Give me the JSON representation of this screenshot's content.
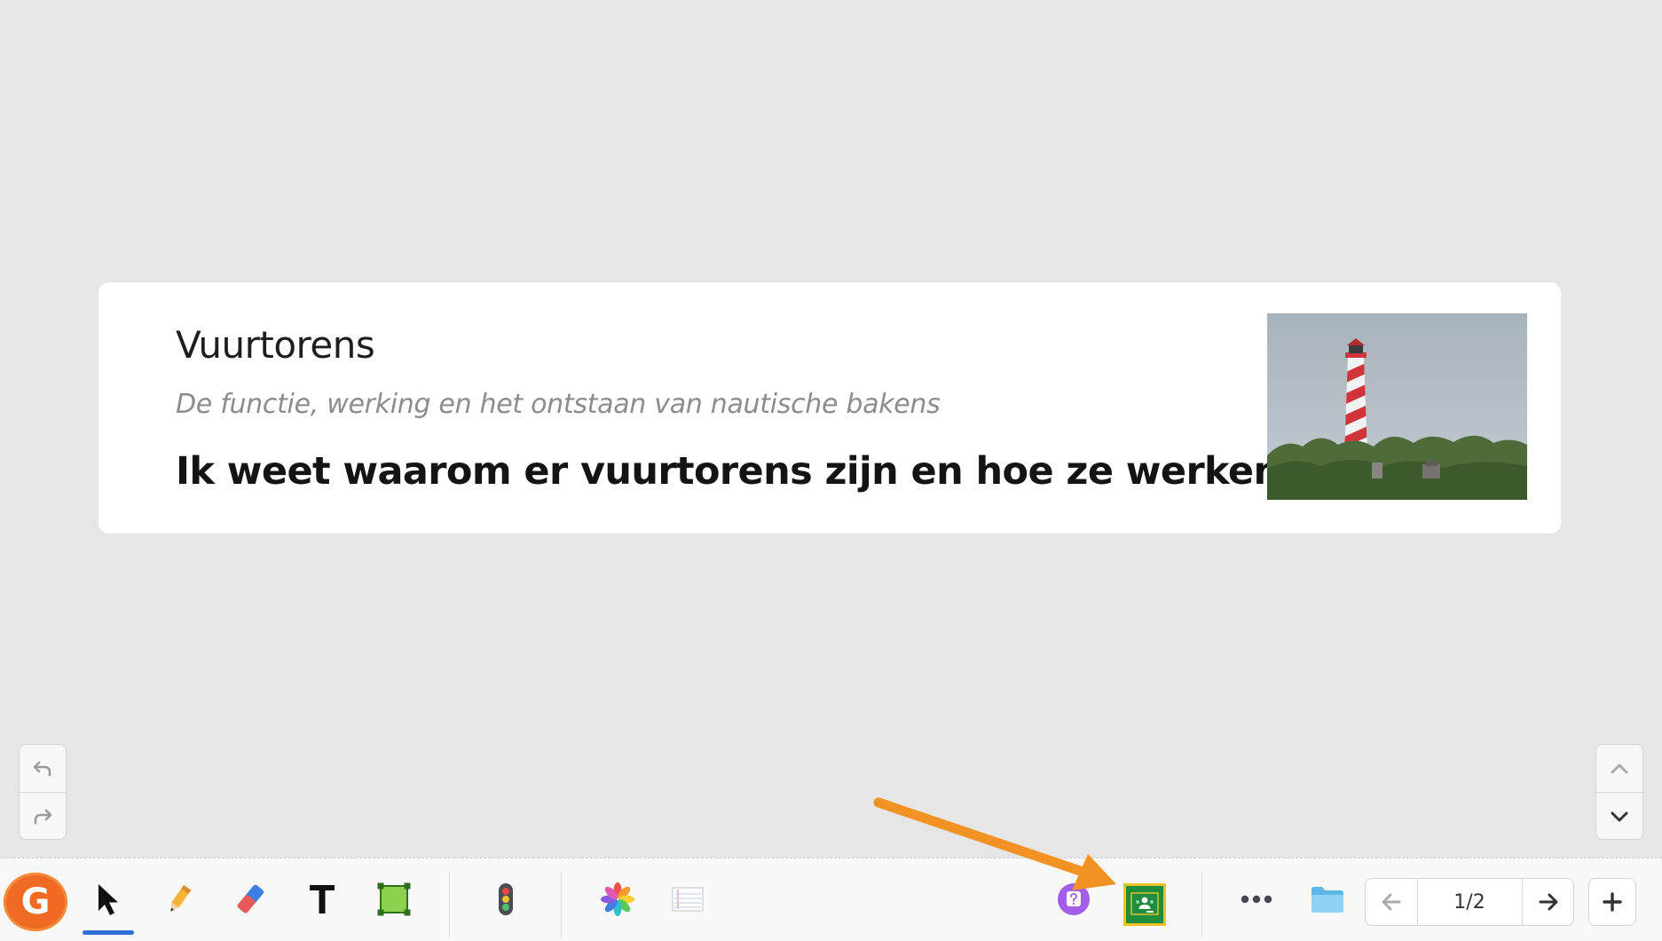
{
  "slide": {
    "title": "Vuurtorens",
    "subtitle": "De functie, werking en het ontstaan van nautische bakens",
    "goal": "Ik weet waarom er vuurtorens zijn en hoe ze werken."
  },
  "navigation": {
    "page_indicator": "1/2"
  },
  "toolbar": {
    "logo_letter": "G",
    "active_tool": "select",
    "tools": [
      "select",
      "pencil",
      "eraser",
      "text",
      "shape",
      "traffic-light",
      "pinwheel",
      "notes"
    ],
    "right_tools": [
      "quiz",
      "classroom",
      "more",
      "folder"
    ]
  },
  "colors": {
    "logo": "#f06a24",
    "active_underline": "#2f6fd6",
    "highlight_border": "#f2c224",
    "classroom_green": "#1e8e3e",
    "annotation_arrow": "#f39224",
    "quiz_purple": "#a25ee8"
  }
}
